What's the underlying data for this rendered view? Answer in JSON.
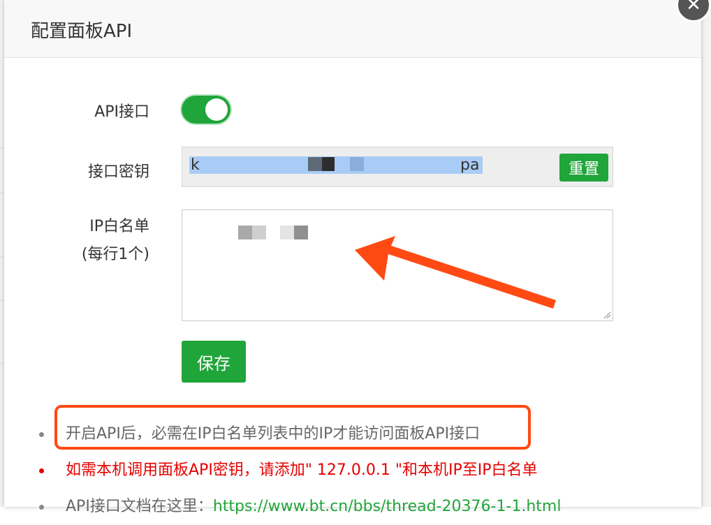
{
  "modal": {
    "title": "配置面板API",
    "close_glyph": "✕"
  },
  "form": {
    "api_label": "API接口",
    "api_enabled": true,
    "key_label": "接口密钥",
    "key_value_start": "k",
    "key_value_end": "pa",
    "reset_label": "重置",
    "whitelist_label_line1": "IP白名单",
    "whitelist_label_line2": "(每行1个)",
    "save_label": "保存"
  },
  "tips": [
    {
      "text": "开启API后，必需在IP白名单列表中的IP才能访问面板API接口",
      "color": "gray"
    },
    {
      "text": "如需本机调用面板API密钥，请添加\" 127.0.0.1 \"和本机IP至IP白名单",
      "color": "red"
    },
    {
      "text": "API接口文档在这里：",
      "link": "https://www.bt.cn/bbs/thread-20376-1-1.html",
      "color": "gray"
    }
  ],
  "colors": {
    "accent": "#20a53a",
    "annotation": "#ff4a14",
    "warning": "#e50000"
  }
}
